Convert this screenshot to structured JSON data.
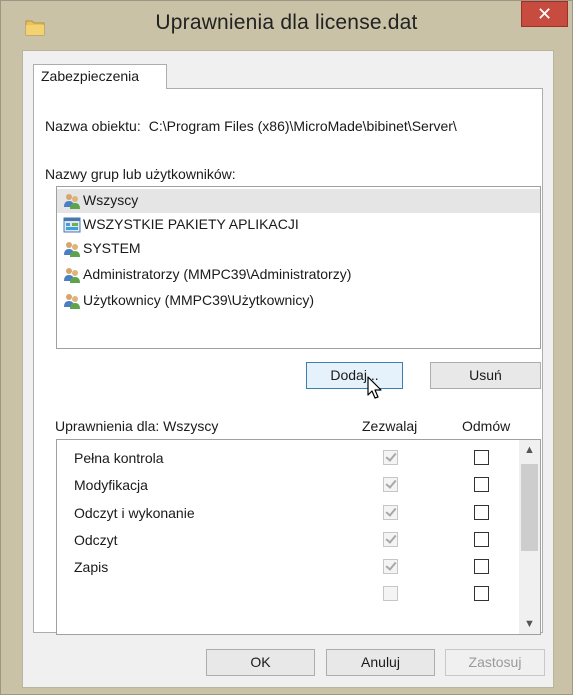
{
  "window": {
    "title": "Uprawnienia dla license.dat",
    "close_glyph": "✕"
  },
  "tabs": [
    {
      "label": "Zabezpieczenia",
      "selected": true
    }
  ],
  "object": {
    "label": "Nazwa obiektu:",
    "value": "C:\\Program Files (x86)\\MicroMade\\bibinet\\Server\\"
  },
  "groups": {
    "label": "Nazwy grup lub użytkowników:",
    "items": [
      {
        "label": "Wszyscy",
        "icon": "users-group-icon",
        "selected": true
      },
      {
        "label": "WSZYSTKIE PAKIETY APLIKACJI",
        "icon": "app-packages-icon",
        "selected": false
      },
      {
        "label": "SYSTEM",
        "icon": "users-group-icon",
        "selected": false
      },
      {
        "label": "Administratorzy (MMPC39\\Administratorzy)",
        "icon": "users-group-icon",
        "selected": false
      },
      {
        "label": "Użytkownicy (MMPC39\\Użytkownicy)",
        "icon": "users-group-icon",
        "selected": false
      }
    ]
  },
  "group_buttons": {
    "add": "Dodaj...",
    "remove": "Usuń"
  },
  "permissions": {
    "label": "Uprawnienia dla: Wszyscy",
    "allow_header": "Zezwalaj",
    "deny_header": "Odmów",
    "rows": [
      {
        "name": "Pełna kontrola",
        "allow": true,
        "deny": false
      },
      {
        "name": "Modyfikacja",
        "allow": true,
        "deny": false
      },
      {
        "name": "Odczyt i wykonanie",
        "allow": true,
        "deny": false
      },
      {
        "name": "Odczyt",
        "allow": true,
        "deny": false
      },
      {
        "name": "Zapis",
        "allow": true,
        "deny": false
      }
    ]
  },
  "footer": {
    "ok": "OK",
    "cancel": "Anuluj",
    "apply": "Zastosuj"
  },
  "colors": {
    "window_frame": "#c9c2a7",
    "close_button": "#c74b3e",
    "selection": "#e5e5e5",
    "focus_border": "#3c7fb1"
  }
}
